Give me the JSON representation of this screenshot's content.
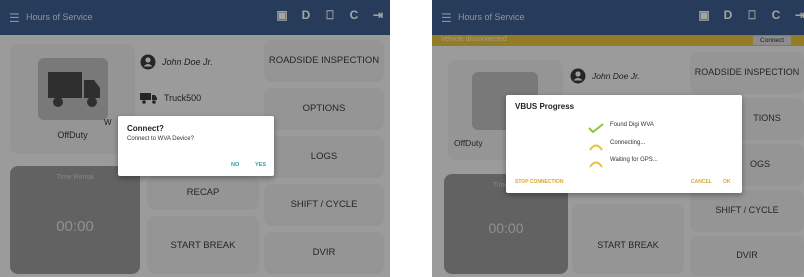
{
  "left": {
    "app_title": "Hours of Service",
    "actions": [
      "▣",
      "D",
      "⎕",
      "C",
      "⇥"
    ],
    "driver_name": "John Doe Jr.",
    "vehicle": "Truck500",
    "status": "OffDuty",
    "time_remaining_label": "Time Remai",
    "time_value": "00:00",
    "peek_label": "W",
    "buttons": {
      "roadside": "ROADSIDE INSPECTION",
      "options": "OPTIONS",
      "logs": "LOGS",
      "recap": "RECAP",
      "shift": "SHIFT / CYCLE",
      "start_break": "START BREAK",
      "dvir": "DVIR"
    },
    "dialog": {
      "title": "Connect?",
      "message": "Connect to WVA Device?",
      "no": "NO",
      "yes": "YES"
    }
  },
  "right": {
    "app_title": "Hours of Service",
    "warning": "Vehicle disconnected",
    "connect_label": "Connect",
    "actions": [
      "▣",
      "D",
      "⎕",
      "C",
      "⇥"
    ],
    "driver_name": "John Doe Jr.",
    "status": "OffDuty",
    "time_remaining_label": "Time Re",
    "time_value": "00:00",
    "buttons": {
      "roadside": "ROADSIDE INSPECTION",
      "options": "TIONS",
      "logs": "OGS",
      "shift": "SHIFT / CYCLE",
      "start_break": "START BREAK",
      "dvir": "DVIR"
    },
    "dialog": {
      "title": "VBUS Progress",
      "steps": [
        "Found Digi WVA",
        "Connecting...",
        "Waiting for GPS..."
      ],
      "stop": "STOP CONNECTION",
      "cancel": "CANCEL",
      "ok": "OK"
    }
  },
  "colors": {
    "appbar": "#3e5f8f",
    "warning": "#e8c23c",
    "accent": "#2aa0a0",
    "check": "#8cc63f"
  }
}
